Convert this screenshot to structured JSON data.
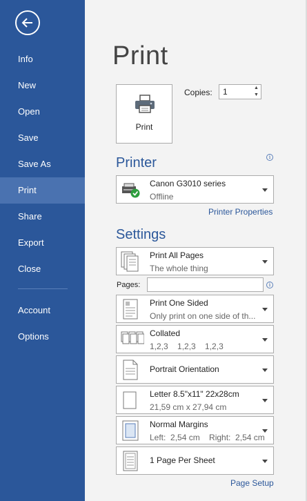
{
  "sidebar": {
    "back_icon": "back-arrow-icon",
    "items": [
      {
        "label": "Info"
      },
      {
        "label": "New"
      },
      {
        "label": "Open"
      },
      {
        "label": "Save"
      },
      {
        "label": "Save As"
      },
      {
        "label": "Print",
        "active": true
      },
      {
        "label": "Share"
      },
      {
        "label": "Export"
      },
      {
        "label": "Close"
      },
      {
        "label": "Account"
      },
      {
        "label": "Options"
      }
    ]
  },
  "main": {
    "title": "Print",
    "print_button": {
      "label": "Print",
      "icon": "printer-icon"
    },
    "copies": {
      "label": "Copies:",
      "value": "1"
    },
    "printer": {
      "section_title": "Printer",
      "name": "Canon G3010 series",
      "status": "Offline",
      "properties_link": "Printer Properties"
    },
    "settings": {
      "section_title": "Settings",
      "print_range": {
        "line1": "Print All Pages",
        "line2": "The whole thing"
      },
      "pages_label": "Pages:",
      "pages_value": "",
      "sides": {
        "line1": "Print One Sided",
        "line2": "Only print on one side of th..."
      },
      "collation": {
        "line1": "Collated",
        "line2": "1,2,3    1,2,3    1,2,3"
      },
      "orientation": {
        "line1": "Portrait Orientation"
      },
      "paper": {
        "line1": "Letter 8.5\"x11\" 22x28cm",
        "line2": "21,59 cm x 27,94 cm"
      },
      "margins": {
        "line1": "Normal Margins",
        "line2": "Left:  2,54 cm    Right:  2,54 cm"
      },
      "per_sheet": {
        "line1": "1 Page Per Sheet"
      },
      "page_setup_link": "Page Setup"
    }
  },
  "colors": {
    "sidebar": "#2b579a",
    "sidebar_active": "#4a72b0",
    "accent": "#2b579a",
    "background": "#f3f3f3"
  }
}
